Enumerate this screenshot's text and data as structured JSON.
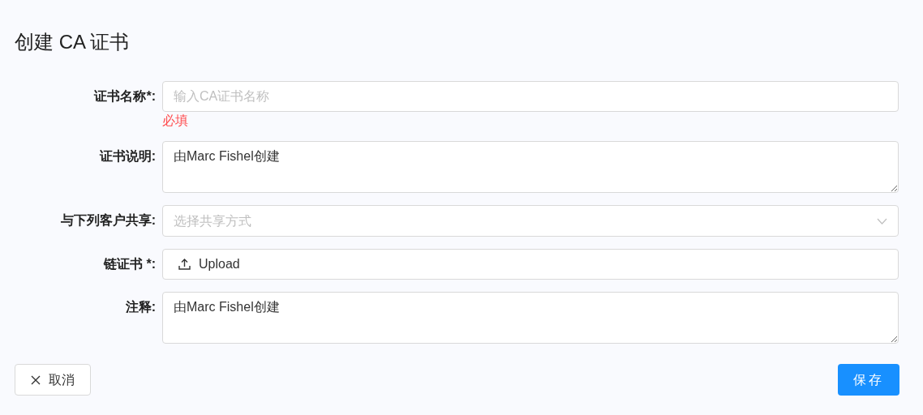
{
  "title": "创建 CA 证书",
  "fields": [
    {
      "kind": "text",
      "label": "证书名称*:",
      "placeholder": "输入CA证书名称",
      "error": "必填"
    },
    {
      "kind": "textarea",
      "label": "证书说明:",
      "value": "由Marc Fishel创建"
    },
    {
      "kind": "select",
      "label": "与下列客户共享:",
      "placeholder": "选择共享方式"
    },
    {
      "kind": "upload",
      "label": "链证书 *:",
      "button": "Upload"
    },
    {
      "kind": "textarea",
      "label": "注释:",
      "value": "由Marc Fishel创建"
    }
  ],
  "cancel": "取消",
  "save": "保存"
}
